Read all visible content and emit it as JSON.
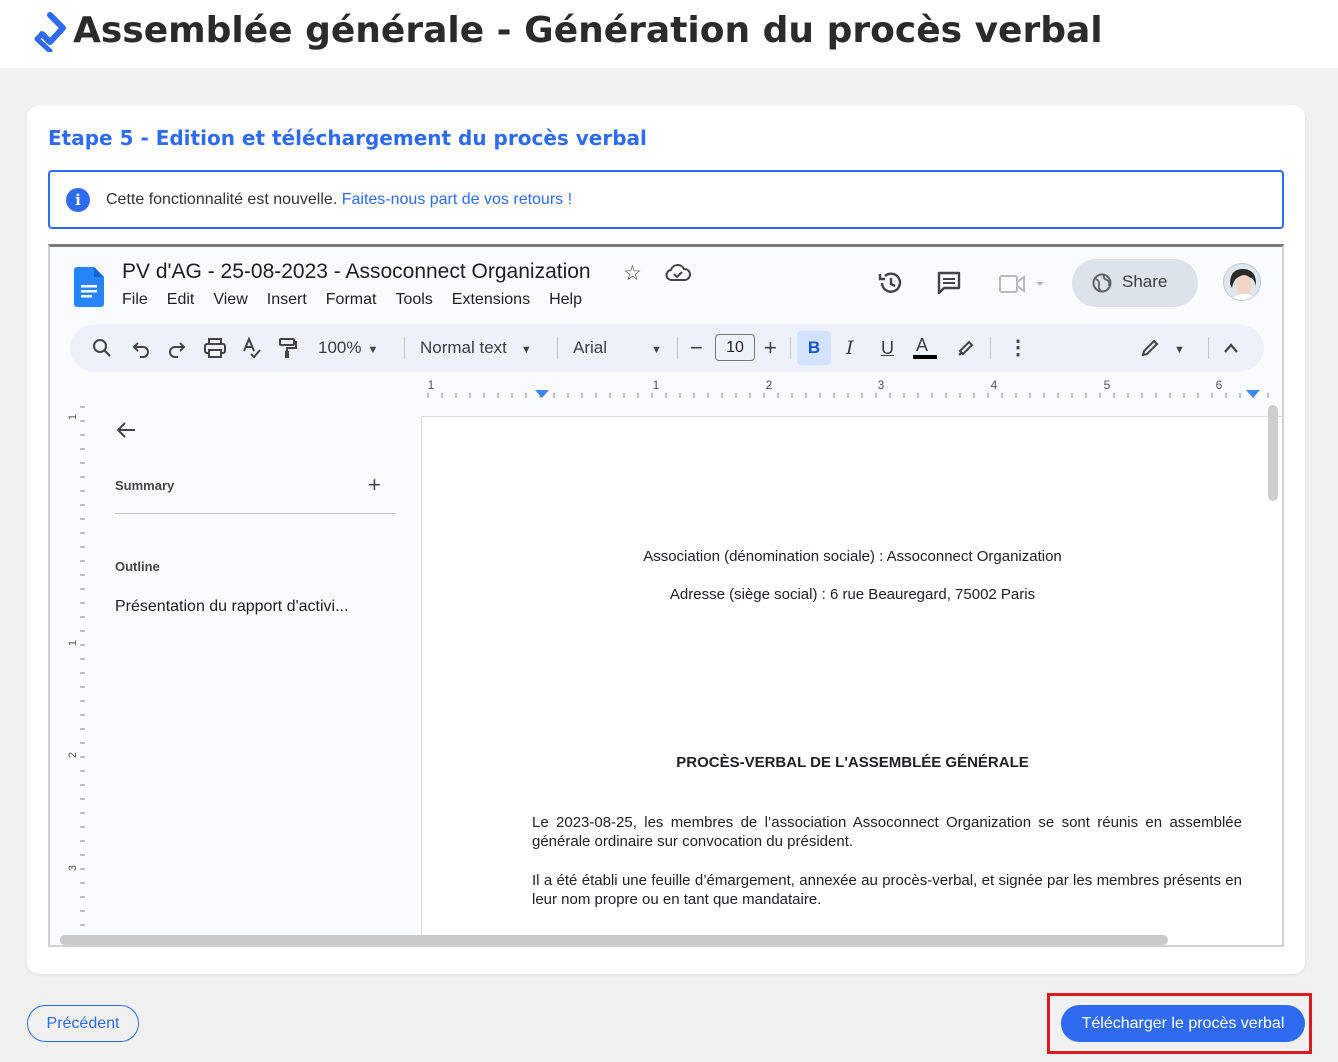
{
  "app": {
    "title": "Assemblée générale - Génération du procès verbal",
    "step_title": "Etape 5 - Edition et téléchargement du procès verbal",
    "accent_color": "#2f6bf0",
    "info": {
      "text": "Cette fonctionnalité est nouvelle.",
      "link": "Faites-nous part de vos retours !"
    }
  },
  "gdoc": {
    "title": "PV d'AG - 25-08-2023 - Assoconnect Organization",
    "menu": [
      "File",
      "Edit",
      "View",
      "Insert",
      "Format",
      "Tools",
      "Extensions",
      "Help"
    ],
    "share_label": "Share",
    "toolbar": {
      "zoom": "100%",
      "style": "Normal text",
      "font": "Arial",
      "font_size": "10",
      "bold": "B",
      "italic": "I",
      "underline": "U",
      "text_color": "A"
    },
    "ruler_h_labels": [
      "1",
      "1",
      "2",
      "3",
      "4",
      "5",
      "6"
    ],
    "ruler_v_labels": [
      "1",
      "1",
      "2",
      "3"
    ],
    "outline": {
      "summary_label": "Summary",
      "outline_label": "Outline",
      "items": [
        "Présentation du rapport d'activi..."
      ]
    },
    "page": {
      "line1": "Association (dénomination sociale) : Assoconnect Organization",
      "line2": "Adresse (siège social) : 6 rue Beauregard, 75002 Paris",
      "heading": "PROCÈS-VERBAL DE L'ASSEMBLÉE GÉNÉRALE",
      "para1": "Le 2023-08-25, les membres de l’association Assoconnect Organization se sont réunis en assemblée générale ordinaire sur convocation du président.",
      "para2": "Il a été établi une feuille d’émargement, annexée au procès-verbal, et signée par les membres présents en leur nom propre ou en tant que mandataire."
    }
  },
  "footer": {
    "prev_label": "Précédent",
    "download_label": "Télécharger le procès verbal",
    "highlight_color": "#e0191f"
  }
}
